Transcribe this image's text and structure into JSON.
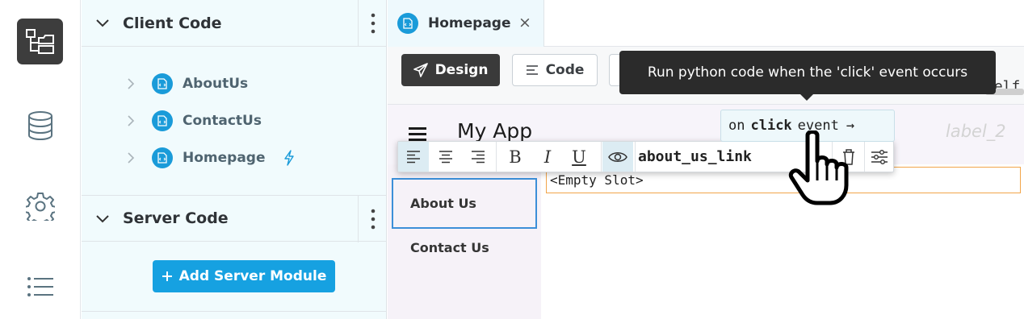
{
  "sidebar_rail": {
    "items": [
      {
        "icon": "app-tree-icon",
        "active": true
      },
      {
        "icon": "database-icon",
        "active": false
      },
      {
        "icon": "gear-icon",
        "active": false
      },
      {
        "icon": "list-icon",
        "active": false
      }
    ]
  },
  "tree": {
    "client_section_title": "Client Code",
    "client_items": [
      {
        "label": "AboutUs"
      },
      {
        "label": "ContactUs"
      },
      {
        "label": "Homepage"
      }
    ],
    "server_section_title": "Server Code",
    "add_server_label": "Add Server Module"
  },
  "editor": {
    "tab_label": "Homepage",
    "tab_close": "×",
    "design_label": "Design",
    "code_label": "Code",
    "code_peek": "self",
    "code_peek_symbol": ">",
    "tooltip": "Run python code when the 'click' event occurs"
  },
  "canvas": {
    "app_title": "My App",
    "label_placeholder": "label_2",
    "nav_about": "About Us",
    "nav_contact": "Contact Us",
    "empty_slot": "<Empty Slot>"
  },
  "float_toolbar": {
    "component_name": "about_us_link",
    "bold": "B",
    "italic": "I",
    "underline": "U"
  },
  "event_pill": {
    "prefix": "on",
    "event": "click",
    "suffix": "event",
    "arrow": "→"
  },
  "colors": {
    "accent": "#16a1e1",
    "dark": "#3a3a3a",
    "tree_bg": "#f1fbfd",
    "selection": "#f2a54a"
  }
}
